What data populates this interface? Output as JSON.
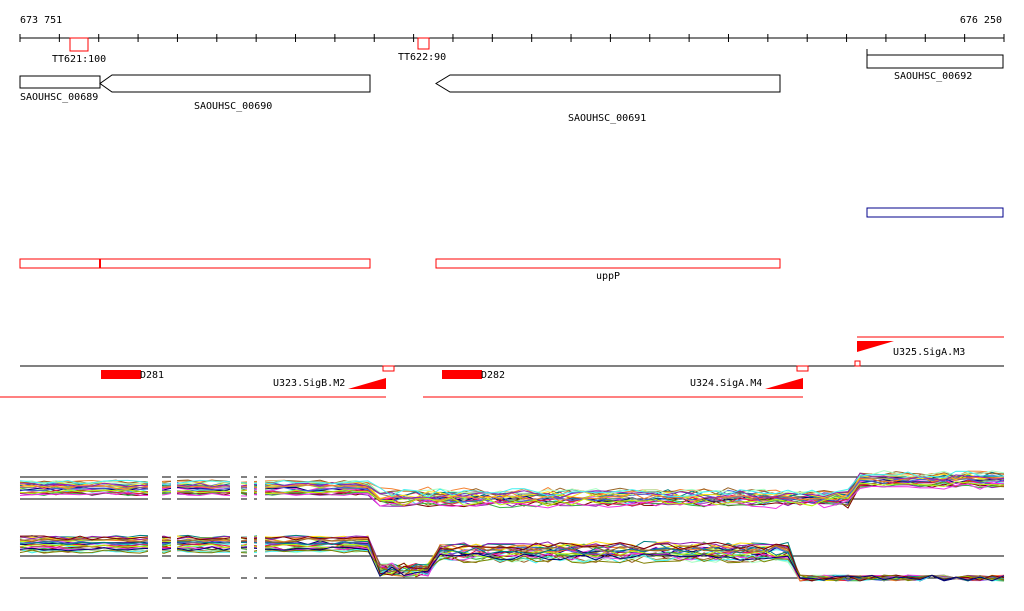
{
  "region": {
    "start_label": "673 751",
    "end_label": "676 250"
  },
  "terminators": [
    {
      "label": "TT621:100"
    },
    {
      "label": "TT622:90"
    }
  ],
  "genes": [
    {
      "label": "SAOUHSC_00689",
      "strand": "-"
    },
    {
      "label": "SAOUHSC_00690",
      "strand": "-"
    },
    {
      "label": "SAOUHSC_00691",
      "strand": "-"
    },
    {
      "label": "SAOUHSC_00692",
      "strand": "+"
    }
  ],
  "red_track": {
    "label": "uppP"
  },
  "dtrack": [
    {
      "label": "D281"
    },
    {
      "label": "D282"
    }
  ],
  "utracks": [
    {
      "label": "U323.SigB.M2"
    },
    {
      "label": "U324.SigA.M4"
    },
    {
      "label": "U325.SigA.M3"
    }
  ],
  "colors": {
    "gene_outline": "#000000",
    "red_feature": "#ff0000",
    "blue_feature": "#00008b",
    "profile_palette": [
      "#3cb44b",
      "#e6194b",
      "#4363d8",
      "#f58231",
      "#911eb4",
      "#46f0f0",
      "#f032e6",
      "#bcf60c",
      "#008080",
      "#9a6324",
      "#800000",
      "#808000",
      "#000075",
      "#808080",
      "#ffe119",
      "#aaffc3"
    ]
  }
}
